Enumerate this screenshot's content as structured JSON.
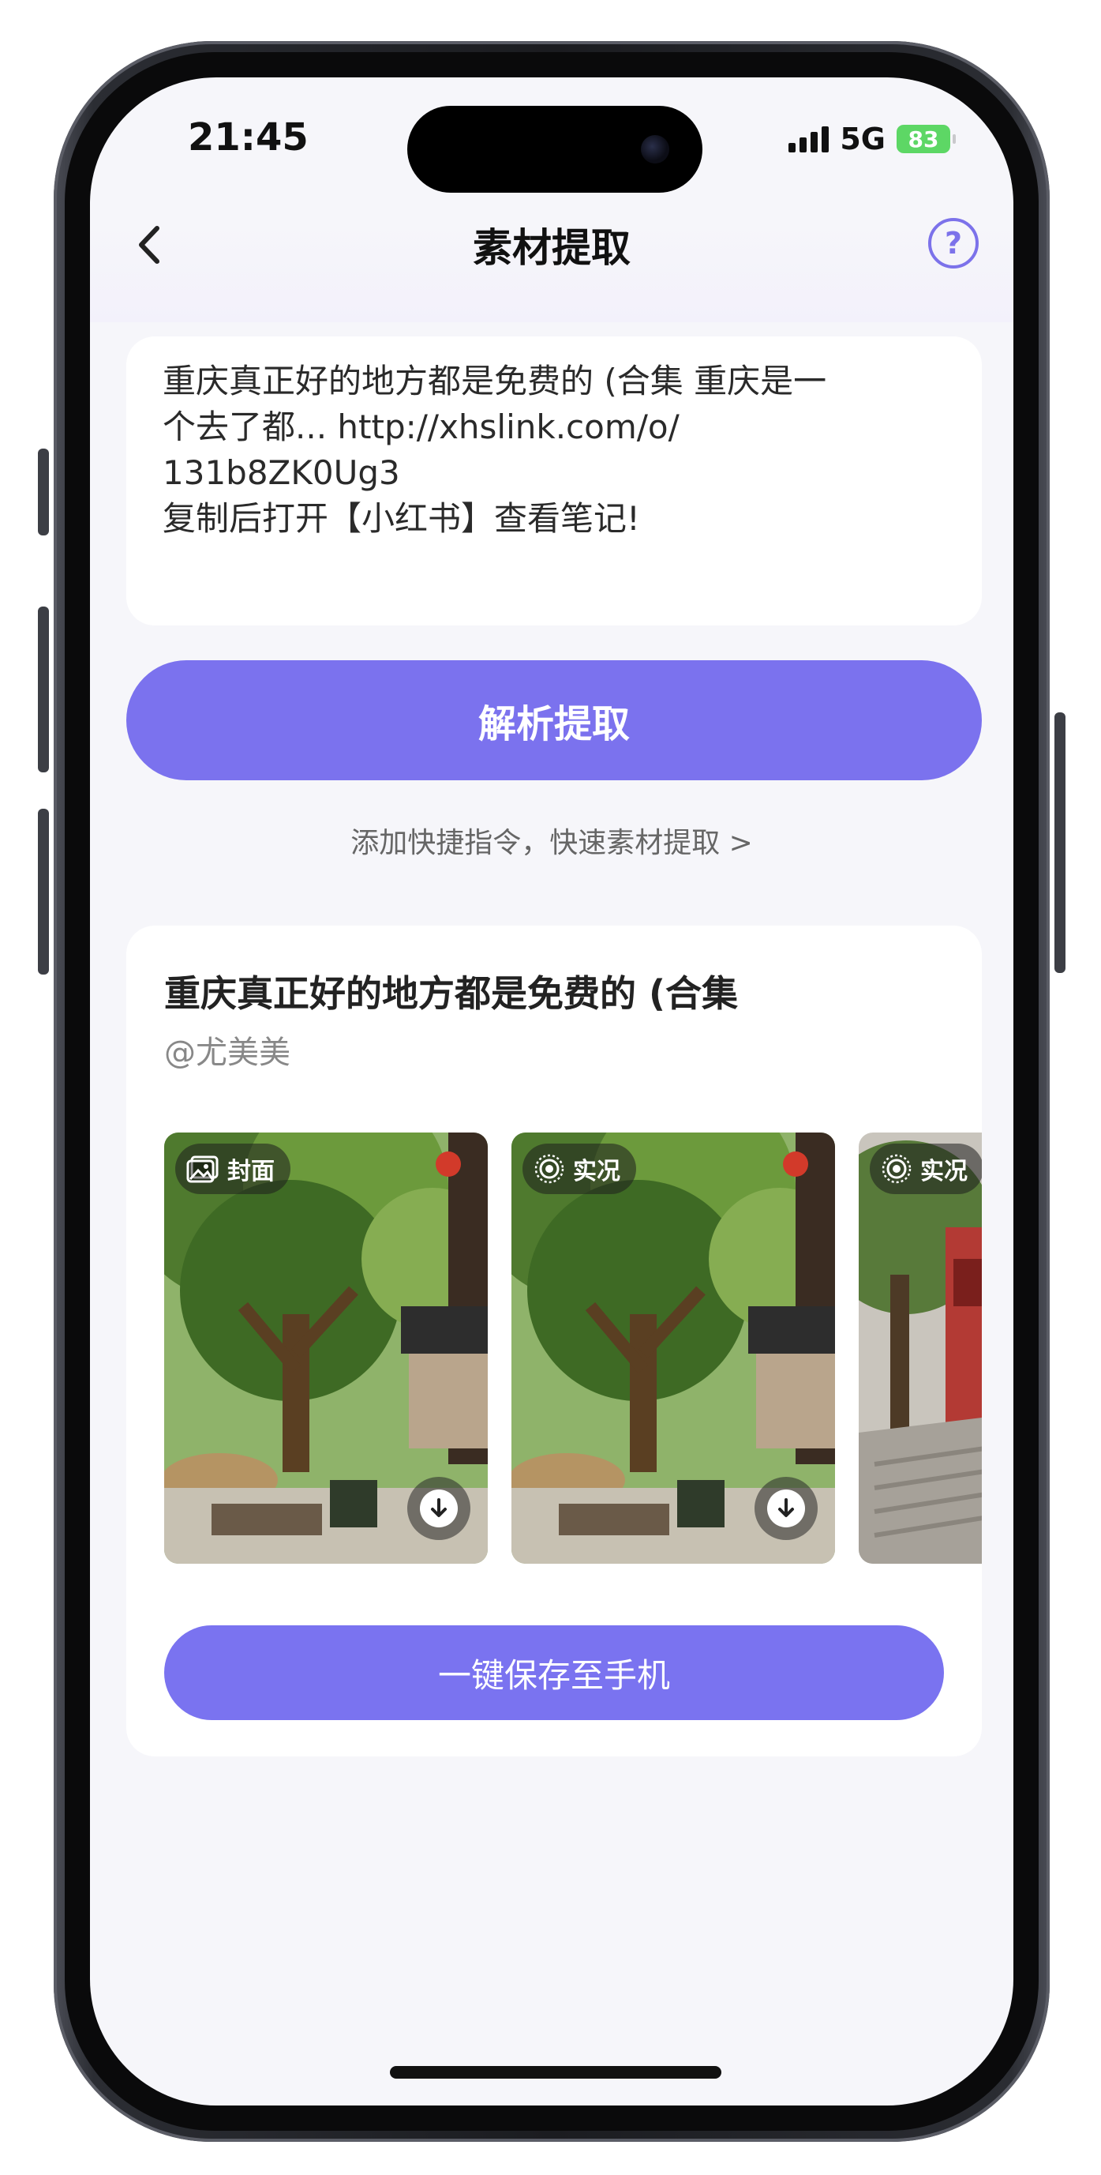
{
  "status_bar": {
    "time": "21:45",
    "network": "5G",
    "battery": "83"
  },
  "nav": {
    "title": "素材提取",
    "help_label": "?"
  },
  "input": {
    "text": "重庆真正好的地方都是免费的 (合集 重庆是一\n个去了都... http://xhslink.com/o/\n131b8ZK0Ug3\n复制后打开【小红书】查看笔记!"
  },
  "parse_button": {
    "label": "解析提取"
  },
  "shortcut_link": {
    "label": "添加快捷指令，快速素材提取 >"
  },
  "result": {
    "title": "重庆真正好的地方都是免费的 (合集",
    "author": "@尤美美",
    "media": [
      {
        "badge": "封面",
        "icon": "image-icon"
      },
      {
        "badge": "实况",
        "icon": "live-photo-icon"
      },
      {
        "badge": "实况",
        "icon": "live-photo-icon"
      }
    ],
    "save_button": "一键保存至手机"
  },
  "colors": {
    "accent": "#7b72ee",
    "background": "#f6f6fa",
    "card": "#ffffff"
  }
}
